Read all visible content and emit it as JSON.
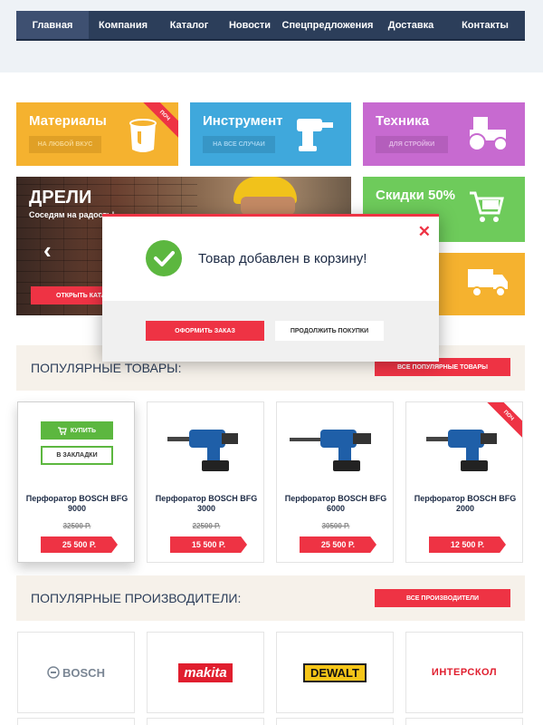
{
  "nav": {
    "items": [
      "Главная",
      "Компания",
      "Каталог",
      "Новости",
      "Спецпредложения",
      "Доставка",
      "Контакты"
    ]
  },
  "tiles": {
    "materials": {
      "title": "Материалы",
      "button": "НА ЛЮБОЙ ВКУС",
      "ribbon": "ПОЧ",
      "color": "#f5b22f",
      "icon": "paint-bucket-icon"
    },
    "tools": {
      "title": "Инструмент",
      "button": "НА ВСЕ СЛУЧАИ",
      "color": "#3fa8dc",
      "icon": "drill-icon"
    },
    "machinery": {
      "title": "Техника",
      "button": "ДЛЯ СТРОЙКИ",
      "color": "#c76ad0",
      "icon": "tractor-icon"
    },
    "discounts": {
      "title": "Скидки 50%",
      "color": "#6ecb5b",
      "icon": "cart-icon"
    },
    "delivery": {
      "color": "#f5b22f",
      "icon": "truck-icon"
    }
  },
  "promo": {
    "title": "ДРЕЛИ",
    "subtitle": "Соседям на радость!",
    "button": "ОТКРЫТЬ КАТАЛ"
  },
  "popular": {
    "title": "ПОПУЛЯРНЫЕ ТОВАРЫ:",
    "button": "ВСЕ ПОПУЛЯРНЫЕ ТОВАРЫ",
    "buy_label": "КУПИТЬ",
    "bookmark_label": "В ЗАКЛАДКИ",
    "ribbon": "ПОЧ",
    "products": [
      {
        "name": "Перфоратор BOSCH BFG 9000",
        "old_price": "32500 Р.",
        "price": "25 500 Р."
      },
      {
        "name": "Перфоратор BOSCH BFG 3000",
        "old_price": "22500 Р.",
        "price": "15 500 Р."
      },
      {
        "name": "Перфоратор BOSCH BFG 6000",
        "old_price": "30500 Р.",
        "price": "25 500 Р."
      },
      {
        "name": "Перфоратор BOSCH BFG 2000",
        "old_price": "",
        "price": "12 500 Р."
      }
    ]
  },
  "manufacturers": {
    "title": "ПОПУЛЯРНЫЕ ПРОИЗВОДИТЕЛИ:",
    "button": "ВСЕ ПРОИЗВОДИТЕЛИ",
    "brands": [
      "BOSCH",
      "makita",
      "DEWALT",
      "ИНТЕРСКОЛ"
    ]
  },
  "modal": {
    "message": "Товар добавлен в корзину!",
    "order_button": "ОФОРМИТЬ ЗАКАЗ",
    "continue_button": "ПРОДОЛЖИТЬ ПОКУПКИ",
    "close_icon": "close-icon",
    "check_icon": "check-icon"
  }
}
